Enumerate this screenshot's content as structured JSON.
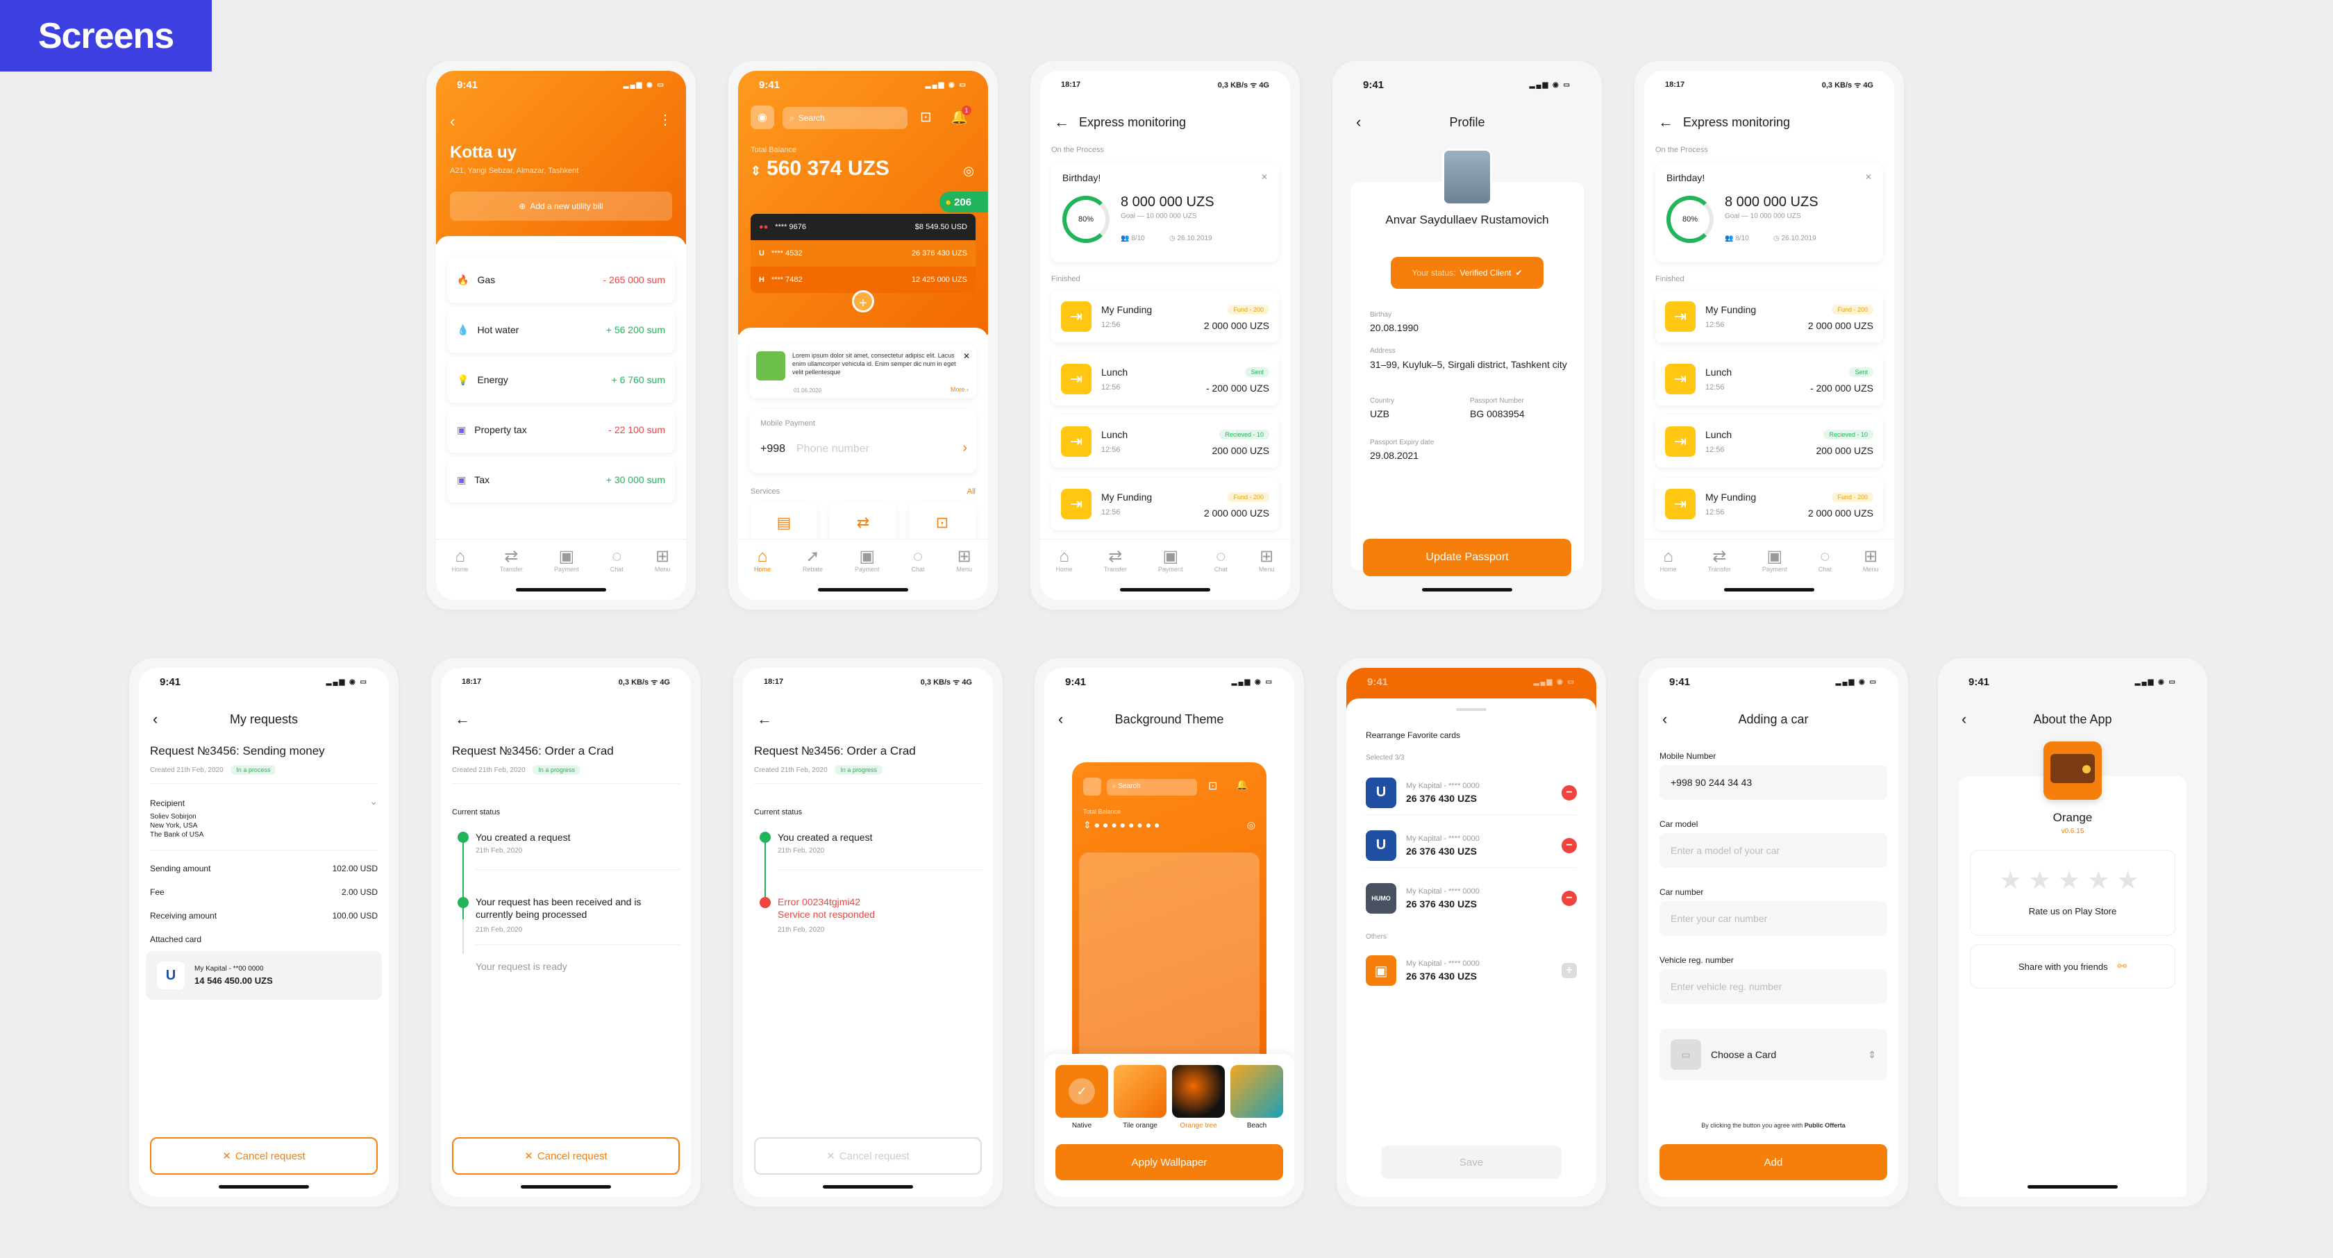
{
  "tag": "Screens",
  "nav": {
    "home": "Home",
    "transfer": "Transfer",
    "payment": "Payment",
    "chat": "Chat",
    "menu": "Menu",
    "rebate": "Rebate"
  },
  "s1": {
    "time": "9:41",
    "title": "Kotta uy",
    "address": "A21, Yangi Sebzar, Almazar, Tashkent",
    "add": "Add a new utility bill",
    "items": [
      {
        "label": "Gas",
        "value": "- 265 000 sum"
      },
      {
        "label": "Hot water",
        "value": "+ 56 200 sum"
      },
      {
        "label": "Energy",
        "value": "+ 6 760 sum"
      },
      {
        "label": "Property tax",
        "value": "- 22 100 sum"
      },
      {
        "label": "Tax",
        "value": "+ 30 000 sum"
      }
    ]
  },
  "s2": {
    "time": "9:41",
    "search": "Search",
    "badge": "1",
    "balance_label": "Total Balance",
    "balance": "560 374 UZS",
    "coins": "206",
    "cards": [
      {
        "num": "**** 9676",
        "amount": "$8 549.50 USD"
      },
      {
        "num": "**** 4532",
        "amount": "26 376 430 UZS"
      },
      {
        "num": "**** 7482",
        "amount": "12 425 000 UZS"
      }
    ],
    "promo": "Lorem ipsum dolor sit amet, consectetur adipisc elit. Lacus enim ullamcorper vehicula id. Enim semper dic num in eget velit pellentesque",
    "promo_date": "01.06.2020",
    "more": "More ›",
    "mobile_label": "Mobile Payment",
    "prefix": "+998",
    "phone_ph": "Phone number",
    "services": "Services",
    "all": "All"
  },
  "s3": {
    "time": "18:17",
    "net": "0,3 KB/s ᯤ 4G",
    "title": "Express monitoring",
    "onproc": "On the Process",
    "bday": "Birthday!",
    "amount": "8 000 000 UZS",
    "goal": "Goal — 10 000 000 UZS",
    "pct": "80%",
    "count": "8/10",
    "date": "26.10.2019",
    "finished": "Finished",
    "rows": [
      {
        "name": "My Funding",
        "time": "12:56",
        "tag": "Fund - 200",
        "amount": "2 000 000 UZS"
      },
      {
        "name": "Lunch",
        "time": "12:56",
        "tag": "Sent",
        "amount": "- 200 000 UZS"
      },
      {
        "name": "Lunch",
        "time": "12:56",
        "tag": "Recieved - 10",
        "amount": "200 000 UZS"
      },
      {
        "name": "My Funding",
        "time": "12:56",
        "tag": "Fund - 200",
        "amount": "2 000 000 UZS"
      }
    ]
  },
  "s4": {
    "time": "9:41",
    "title": "Profile",
    "name": "Anvar Saydullaev Rustamovich",
    "status_label": "Your status:",
    "status": "Verified Client",
    "bday_label": "Birthay",
    "bday": "20.08.1990",
    "addr_label": "Address",
    "addr": "31–99, Kuyluk–5, Sirgali district, Tashkent city",
    "country_label": "Country",
    "country": "UZB",
    "pass_label": "Passport Number",
    "pass": "BG 0083954",
    "exp_label": "Passport Expiry date",
    "exp": "29.08.2021",
    "button": "Update Passport"
  },
  "s6": {
    "time": "9:41",
    "title": "My requests",
    "req": "Request №3456: Sending money",
    "created": "Created 21th Feb, 2020",
    "status": "In a process",
    "recipient_label": "Recipient",
    "recipient": "Soliev Sobirjon\nNew York, USA\nThe Bank of USA",
    "lines": [
      {
        "label": "Sending amount",
        "value": "102.00 USD"
      },
      {
        "label": "Fee",
        "value": "2.00 USD"
      },
      {
        "label": "Receiving amount",
        "value": "100.00 USD"
      }
    ],
    "attached": "Attached card",
    "card_name": "My Kapital - **00 0000",
    "card_amount": "14 546 450.00 UZS",
    "cancel": "Cancel request"
  },
  "s7": {
    "time": "18:17",
    "net": "0,3 KB/s ᯤ 4G",
    "req": "Request №3456: Order a Crad",
    "created": "Created 21th Feb, 2020",
    "status": "In a progress",
    "current": "Current status",
    "steps": [
      {
        "text": "You created a request",
        "date": "21th Feb, 2020"
      },
      {
        "text": "Your request has been received and is currently being processed",
        "date": "21th Feb, 2020"
      },
      {
        "text": "Your request is ready",
        "date": ""
      }
    ],
    "cancel": "Cancel request"
  },
  "s8": {
    "time": "18:17",
    "net": "0,3 KB/s ᯤ 4G",
    "req": "Request №3456: Order a Crad",
    "created": "Created 21th Feb, 2020",
    "status": "In a progress",
    "current": "Current status",
    "steps": [
      {
        "text": "You created a request",
        "date": "21th Feb, 2020"
      },
      {
        "text": "Error 00234tgjmi42\nService not responded",
        "date": "21th Feb, 2020"
      }
    ],
    "cancel": "Cancel request"
  },
  "s9": {
    "time": "9:41",
    "title": "Background Theme",
    "search": "Search",
    "balance_label": "Total Balance",
    "balance": "● ● ● ● ● ● ● ●",
    "themes": [
      {
        "label": "Native"
      },
      {
        "label": "Tile orange"
      },
      {
        "label": "Orange tree"
      },
      {
        "label": "Beach"
      }
    ],
    "button": "Apply Wallpaper"
  },
  "s10": {
    "time": "9:41",
    "title": "Rearrange Favorite cards",
    "selected": "Selected 3/3",
    "others": "Others",
    "cards": [
      {
        "name": "My Kapital - **** 0000",
        "amount": "26 376 430 UZS"
      },
      {
        "name": "My Kapital - **** 0000",
        "amount": "26 376 430 UZS"
      },
      {
        "name": "My Kapital - **** 0000",
        "amount": "26 376 430 UZS"
      }
    ],
    "other": {
      "name": "My Kapital - **** 0000",
      "amount": "26 376 430 UZS"
    },
    "button": "Save"
  },
  "s11": {
    "time": "9:41",
    "title": "Adding a car",
    "mobile_label": "Mobile Number",
    "mobile": "+998 90 244 34 43",
    "model_label": "Car model",
    "model_ph": "Enter a model of your car",
    "num_label": "Car number",
    "num_ph": "Enter your car number",
    "reg_label": "Vehicle reg. number",
    "reg_ph": "Enter vehicle reg. number",
    "choose": "Choose a Card",
    "agree": "By clicking the button you agree with",
    "agree_link": "Public Offerta",
    "button": "Add"
  },
  "s12": {
    "time": "9:41",
    "title": "About the App",
    "app": "Orange",
    "version": "v0.6.15",
    "rate": "Rate us on Play Store",
    "share": "Share with you friends"
  }
}
